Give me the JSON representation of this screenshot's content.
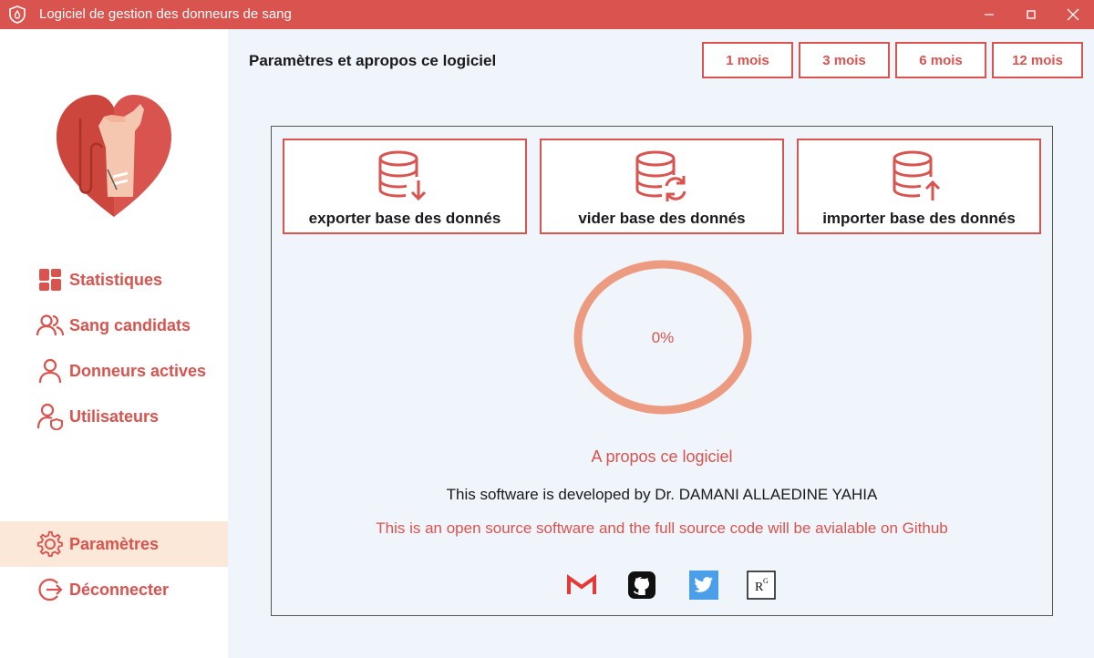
{
  "window": {
    "title": "Logiciel de gestion des donneurs de sang"
  },
  "sidebar": {
    "items": [
      {
        "label": "Statistiques"
      },
      {
        "label": "Sang candidats"
      },
      {
        "label": "Donneurs actives"
      },
      {
        "label": "Utilisateurs"
      },
      {
        "label": "Paramètres",
        "active": true
      },
      {
        "label": "Déconnecter"
      }
    ]
  },
  "header": {
    "title": "Paramètres et apropos ce logiciel",
    "periods": [
      "1 mois",
      "3 mois",
      "6 mois",
      "12 mois"
    ]
  },
  "actions": {
    "export_label": "exporter base des donnés",
    "clear_label": "vider base des donnés",
    "import_label": "importer base des donnés"
  },
  "progress": {
    "value": 0,
    "label": "0%"
  },
  "about": {
    "title": "A propos ce logiciel",
    "developer": "This software is developed by Dr. DAMANI ALLAEDINE YAHIA",
    "open_source": "This is an open source software and the full source code will be avialable on Github"
  },
  "social": [
    "gmail-icon",
    "github-icon",
    "twitter-icon",
    "researchgate-icon"
  ],
  "colors": {
    "accent": "#d9534f",
    "progress_ring": "#ec9a80",
    "active_bg": "#fbe8d8",
    "background": "#f0f4fb"
  }
}
